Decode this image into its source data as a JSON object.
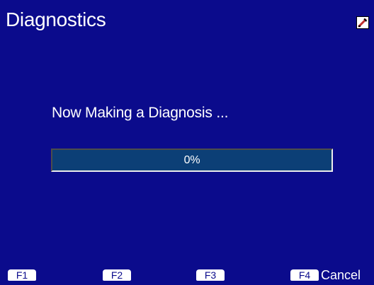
{
  "header": {
    "title": "Diagnostics",
    "pin_icon": "edit-pencil-icon"
  },
  "main": {
    "message": "Now Making a Diagnosis ...",
    "progress": {
      "value": 0,
      "label": "0%"
    }
  },
  "function_keys": [
    {
      "key": "F1",
      "label": ""
    },
    {
      "key": "F2",
      "label": ""
    },
    {
      "key": "F3",
      "label": ""
    },
    {
      "key": "F4",
      "label": "Cancel"
    }
  ],
  "colors": {
    "background": "#0b0b8c",
    "progress_track": "#0c3f76",
    "text": "#ffffff"
  }
}
